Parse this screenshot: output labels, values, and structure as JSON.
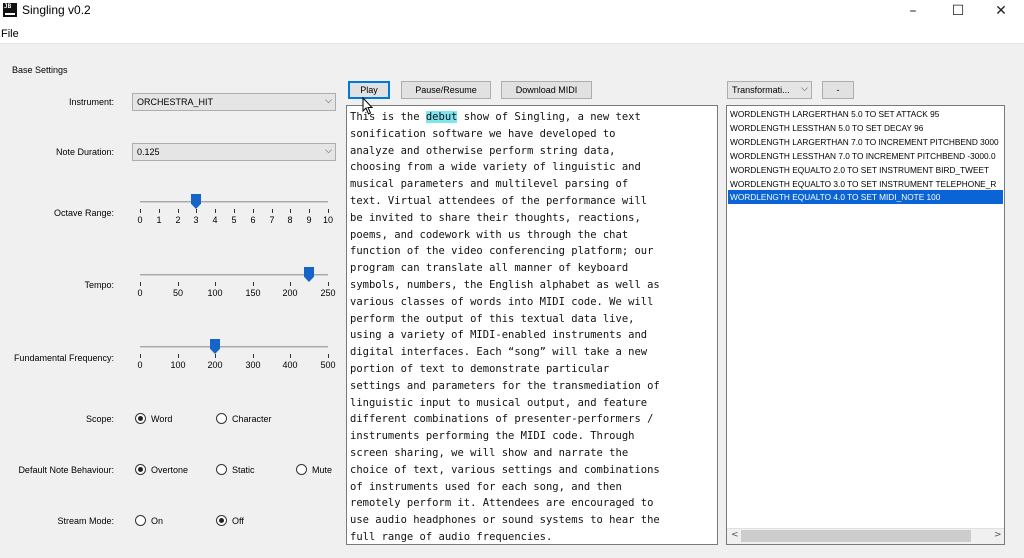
{
  "window": {
    "title": "Singling v0.2",
    "icon_text": "JB",
    "controls": {
      "minimize": "–",
      "maximize": "☐",
      "close": "✕"
    }
  },
  "menu": {
    "file": "File"
  },
  "base_settings": {
    "heading": "Base Settings",
    "instrument": {
      "label": "Instrument:",
      "value": "ORCHESTRA_HIT"
    },
    "note_duration": {
      "label": "Note Duration:",
      "value": "0.125"
    },
    "octave_range": {
      "label": "Octave Range:",
      "value": 3,
      "min": 0,
      "max": 10,
      "ticks": [
        "0",
        "1",
        "2",
        "3",
        "4",
        "5",
        "6",
        "7",
        "8",
        "9",
        "10"
      ]
    },
    "tempo": {
      "label": "Tempo:",
      "value": 225,
      "min": 0,
      "max": 250,
      "ticks": [
        "0",
        "50",
        "100",
        "150",
        "200",
        "250"
      ]
    },
    "fundamental_frequency": {
      "label": "Fundamental Frequency:",
      "value": 200,
      "min": 0,
      "max": 500,
      "ticks": [
        "0",
        "100",
        "200",
        "300",
        "400",
        "500"
      ]
    },
    "scope": {
      "label": "Scope:",
      "options": [
        "Word",
        "Character"
      ],
      "selected": "Word"
    },
    "default_note_behaviour": {
      "label": "Default Note Behaviour:",
      "options": [
        "Overtone",
        "Static",
        "Mute"
      ],
      "selected": "Overtone"
    },
    "stream_mode": {
      "label": "Stream Mode:",
      "options": [
        "On",
        "Off"
      ],
      "selected": "Off"
    }
  },
  "toolbar": {
    "play": "Play",
    "pause_resume": "Pause/Resume",
    "download_midi": "Download MIDI",
    "transformations": "Transformati...",
    "remove": "-"
  },
  "text": {
    "before_highlight": "This is the ",
    "highlight": "debut",
    "after_highlight": " show of Singling, a new text\nsonification software we have developed to\nanalyze and otherwise perform string data,\nchoosing from a wide variety of linguistic and\nmusical parameters and multilevel parsing of\ntext. Virtual attendees of the performance will\nbe invited to share their thoughts, reactions,\npoems, and codework with us through the chat\nfunction of the video conferencing platform; our\nprogram can translate all manner of keyboard\nsymbols, numbers, the English alphabet as well as\nvarious classes of words into MIDI code. We will\nperform the output of this textual data live,\nusing a variety of MIDI-enabled instruments and\ndigital interfaces. Each “song” will take a new\nportion of text to demonstrate particular\nsettings and parameters for the transmediation of\nlinguistic input to musical output, and feature\ndifferent combinations of presenter-performers /\ninstruments performing the MIDI code. Through\nscreen sharing, we will show and narrate the\nchoice of text, various settings and combinations\nof instruments used for each song, and then\nremotely perform it. Attendees are encouraged to\nuse audio headphones or sound systems to hear the\nfull range of audio frequencies."
  },
  "rules": [
    "WORDLENGTH LARGERTHAN 5.0 TO SET ATTACK 95",
    "WORDLENGTH LESSTHAN 5.0 TO SET DECAY 96",
    "WORDLENGTH LARGERTHAN 7.0 TO INCREMENT PITCHBEND 3000",
    "WORDLENGTH LESSTHAN 7.0 TO INCREMENT PITCHBEND -3000.0",
    "WORDLENGTH EQUALTO 2.0 TO SET INSTRUMENT BIRD_TWEET",
    "WORDLENGTH EQUALTO 3.0 TO SET INSTRUMENT TELEPHONE_R",
    "WORDLENGTH EQUALTO 4.0 TO SET MIDI_NOTE 100"
  ],
  "selected_rule_index": 6,
  "icons": {
    "dropdown": "chevron-down-icon",
    "scroll_left": "scroll-left-icon",
    "scroll_right": "scroll-right-icon",
    "cursor": "mouse-pointer-icon"
  },
  "colors": {
    "selection": "#0a64d6",
    "slider_thumb": "#1565c8",
    "text_highlight": "#7fe5f0"
  }
}
